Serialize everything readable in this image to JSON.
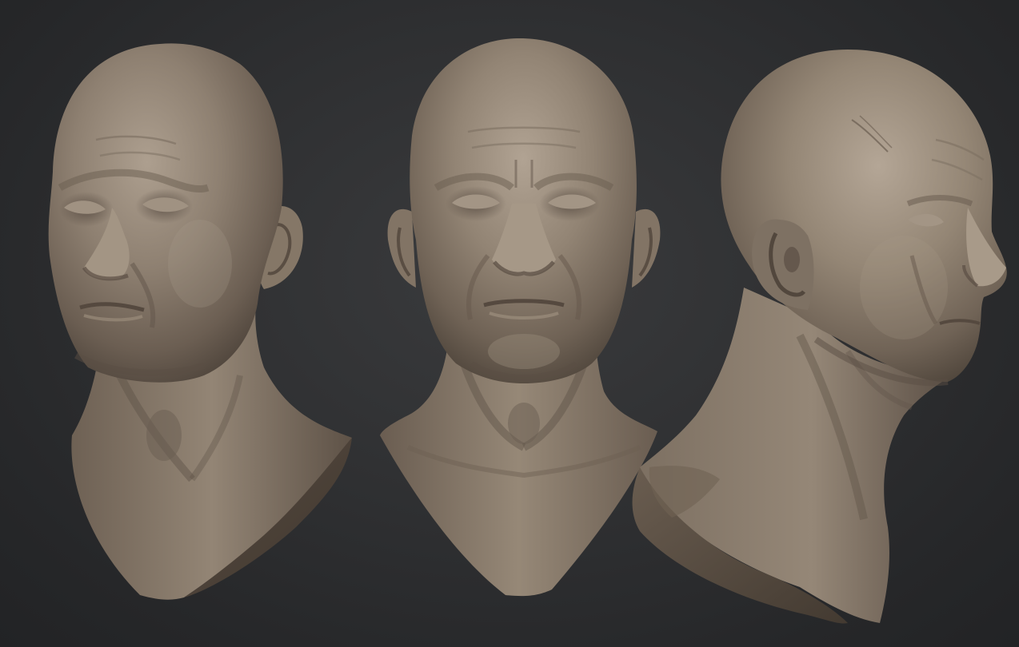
{
  "scene": {
    "background_color": "#2b2c2e",
    "clay_color": "#8c7e70",
    "clay_shadow_color": "#4d4238",
    "clay_highlight_color": "#b3a696",
    "views": [
      {
        "id": "three-quarter-left",
        "icon": "sculpt-bust-three-quarter"
      },
      {
        "id": "front",
        "icon": "sculpt-bust-front"
      },
      {
        "id": "profile-right",
        "icon": "sculpt-bust-profile"
      }
    ]
  }
}
